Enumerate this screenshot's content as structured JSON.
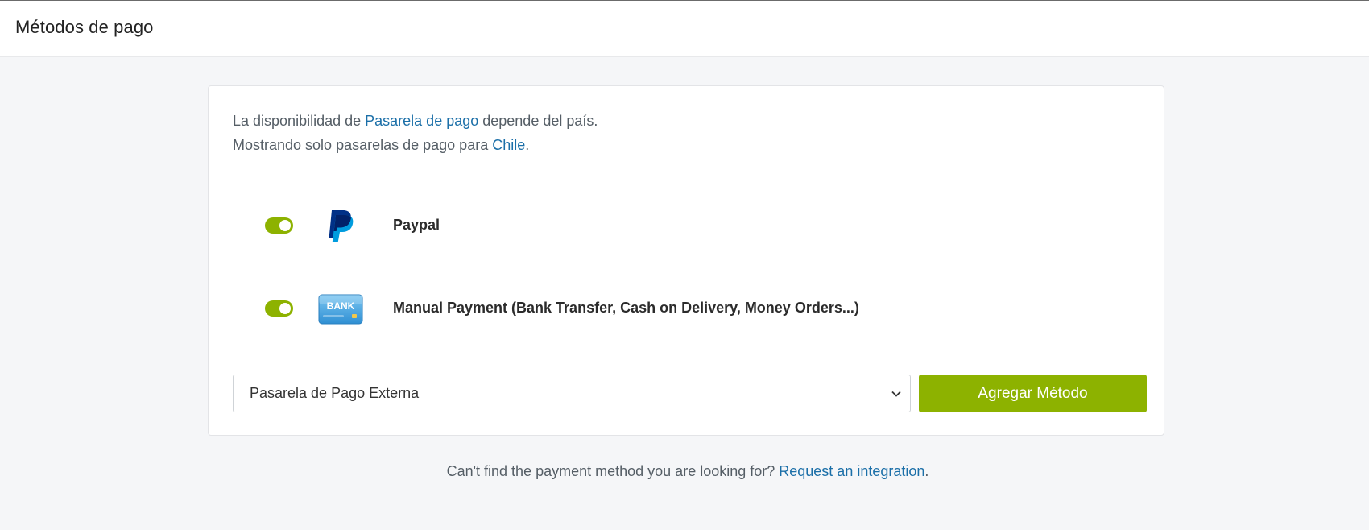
{
  "header": {
    "title": "Métodos de pago"
  },
  "info": {
    "line1_prefix": "La disponibilidad de ",
    "line1_link": "Pasarela de pago",
    "line1_suffix": " depende del país.",
    "line2_prefix": "Mostrando solo pasarelas de pago para ",
    "line2_link": "Chile",
    "line2_suffix": "."
  },
  "methods": [
    {
      "name": "Paypal",
      "enabled": true,
      "icon": "paypal-logo-icon"
    },
    {
      "name": "Manual Payment (Bank Transfer, Cash on Delivery, Money Orders...)",
      "enabled": true,
      "icon": "bank-card-icon",
      "icon_text": "BANK"
    }
  ],
  "add_method": {
    "select_value": "Pasarela de Pago Externa",
    "button_label": "Agregar Método"
  },
  "footer": {
    "prefix": "Can't find the payment method you are looking for? ",
    "link": "Request an integration",
    "suffix": "."
  },
  "colors": {
    "accent_green": "#8db200",
    "link_blue": "#1b6fa8",
    "page_bg": "#f5f6f8"
  }
}
